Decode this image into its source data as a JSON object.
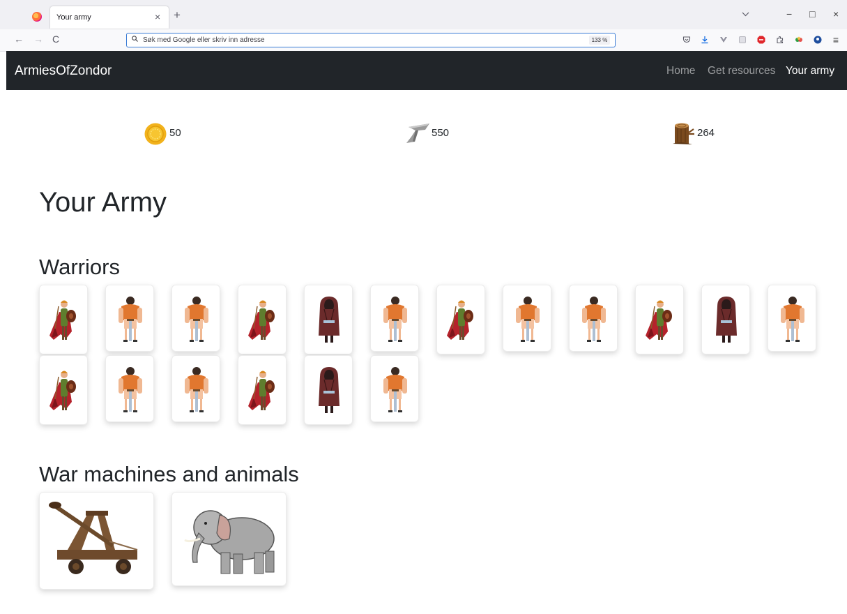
{
  "browser": {
    "tab_title": "Your army",
    "tab_close": "×",
    "new_tab": "+",
    "address_placeholder": "Søk med Google eller skriv inn adresse",
    "zoom": "133 %",
    "back": "←",
    "forward": "→",
    "reload": "C",
    "minimize": "−",
    "maximize": "□",
    "close": "×",
    "menu": "≡"
  },
  "site": {
    "brand": "ArmiesOfZondor",
    "nav": [
      {
        "label": "Home",
        "active": false
      },
      {
        "label": "Get resources",
        "active": false
      },
      {
        "label": "Your army",
        "active": true
      }
    ]
  },
  "resources": [
    {
      "icon": "gold-coin-icon",
      "value": "50"
    },
    {
      "icon": "iron-ingot-icon",
      "value": "550"
    },
    {
      "icon": "wood-log-icon",
      "value": "264"
    }
  ],
  "page_title": "Your Army",
  "sections": {
    "warriors": {
      "heading": "Warriors",
      "units": [
        "archer",
        "barbarian",
        "barbarian",
        "archer",
        "monk",
        "barbarian",
        "archer",
        "barbarian",
        "barbarian",
        "archer",
        "monk",
        "barbarian",
        "archer",
        "barbarian",
        "barbarian",
        "archer",
        "monk",
        "barbarian"
      ]
    },
    "machines": {
      "heading": "War machines and animals",
      "units": [
        "catapult",
        "elephant"
      ]
    }
  },
  "colors": {
    "navbar_bg": "#212529",
    "nav_inactive": "rgba(255,255,255,0.55)",
    "nav_active": "#ffffff",
    "accent_focus": "#3a7bd5"
  }
}
